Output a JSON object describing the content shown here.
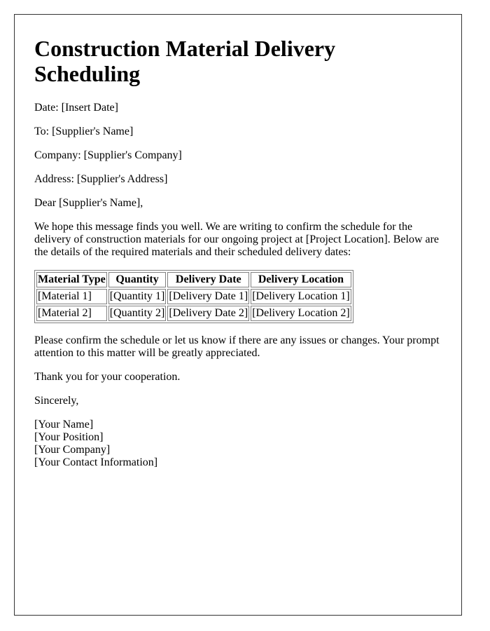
{
  "title": "Construction Material Delivery Scheduling",
  "header_fields": {
    "date": "Date: [Insert Date]",
    "to": "To: [Supplier's Name]",
    "company": "Company: [Supplier's Company]",
    "address": "Address: [Supplier's Address]"
  },
  "salutation": "Dear [Supplier's Name],",
  "intro": "We hope this message finds you well. We are writing to confirm the schedule for the delivery of construction materials for our ongoing project at [Project Location]. Below are the details of the required materials and their scheduled delivery dates:",
  "table": {
    "headers": [
      "Material Type",
      "Quantity",
      "Delivery Date",
      "Delivery Location"
    ],
    "rows": [
      [
        "[Material 1]",
        "[Quantity 1]",
        "[Delivery Date 1]",
        "[Delivery Location 1]"
      ],
      [
        "[Material 2]",
        "[Quantity 2]",
        "[Delivery Date 2]",
        "[Delivery Location 2]"
      ]
    ]
  },
  "closing_request": "Please confirm the schedule or let us know if there are any issues or changes. Your prompt attention to this matter will be greatly appreciated.",
  "thanks": "Thank you for your cooperation.",
  "sign_off": "Sincerely,",
  "signature": {
    "name": "[Your Name]",
    "position": "[Your Position]",
    "company": "[Your Company]",
    "contact": "[Your Contact Information]"
  }
}
